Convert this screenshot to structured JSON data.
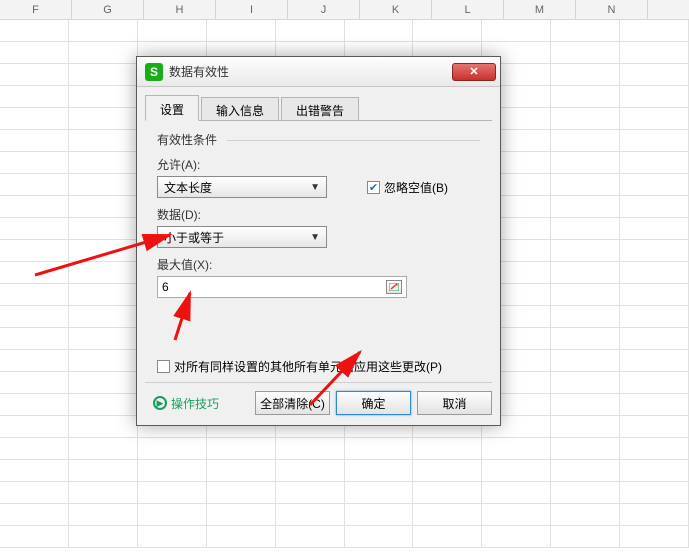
{
  "columns": [
    "F",
    "G",
    "H",
    "I",
    "J",
    "K",
    "L",
    "M",
    "N"
  ],
  "dialog": {
    "title": "数据有效性",
    "tabs": {
      "settings": "设置",
      "input": "输入信息",
      "error": "出错警告"
    },
    "fieldset": "有效性条件",
    "allow_label": "允许(A):",
    "allow_value": "文本长度",
    "ignore_blank_label": "忽略空值(B)",
    "data_label": "数据(D):",
    "data_value": "小于或等于",
    "max_label": "最大值(X):",
    "max_value": "6",
    "apply_label": "对所有同样设置的其他所有单元格应用这些更改(P)",
    "tips": "操作技巧",
    "buttons": {
      "clear": "全部清除(C)",
      "ok": "确定",
      "cancel": "取消"
    }
  }
}
